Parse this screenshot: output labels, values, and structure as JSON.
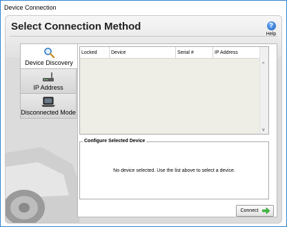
{
  "window": {
    "title": "Device Connection"
  },
  "header": {
    "title": "Select Connection Method",
    "help_label": "Help",
    "help_glyph": "?"
  },
  "nav": {
    "items": [
      {
        "label": "Device Discovery",
        "icon": "magnifier-icon",
        "active": true
      },
      {
        "label": "IP Address",
        "icon": "wireless-router-icon",
        "active": false
      },
      {
        "label": "Disconnected Mode",
        "icon": "laptop-icon",
        "active": false
      }
    ]
  },
  "device_list": {
    "columns": [
      "Locked",
      "Device",
      "Serial #",
      "IP Address"
    ],
    "rows": [],
    "scroll_up_glyph": "^",
    "scroll_down_glyph": "v"
  },
  "config": {
    "legend": "Configure Selected Device",
    "message": "No device selected.  Use the list above to select a device."
  },
  "actions": {
    "connect_label": "Connect"
  },
  "colors": {
    "accent": "#2f7fd0",
    "arrow": "#3fbf3f",
    "help": "#1e5fb8"
  }
}
